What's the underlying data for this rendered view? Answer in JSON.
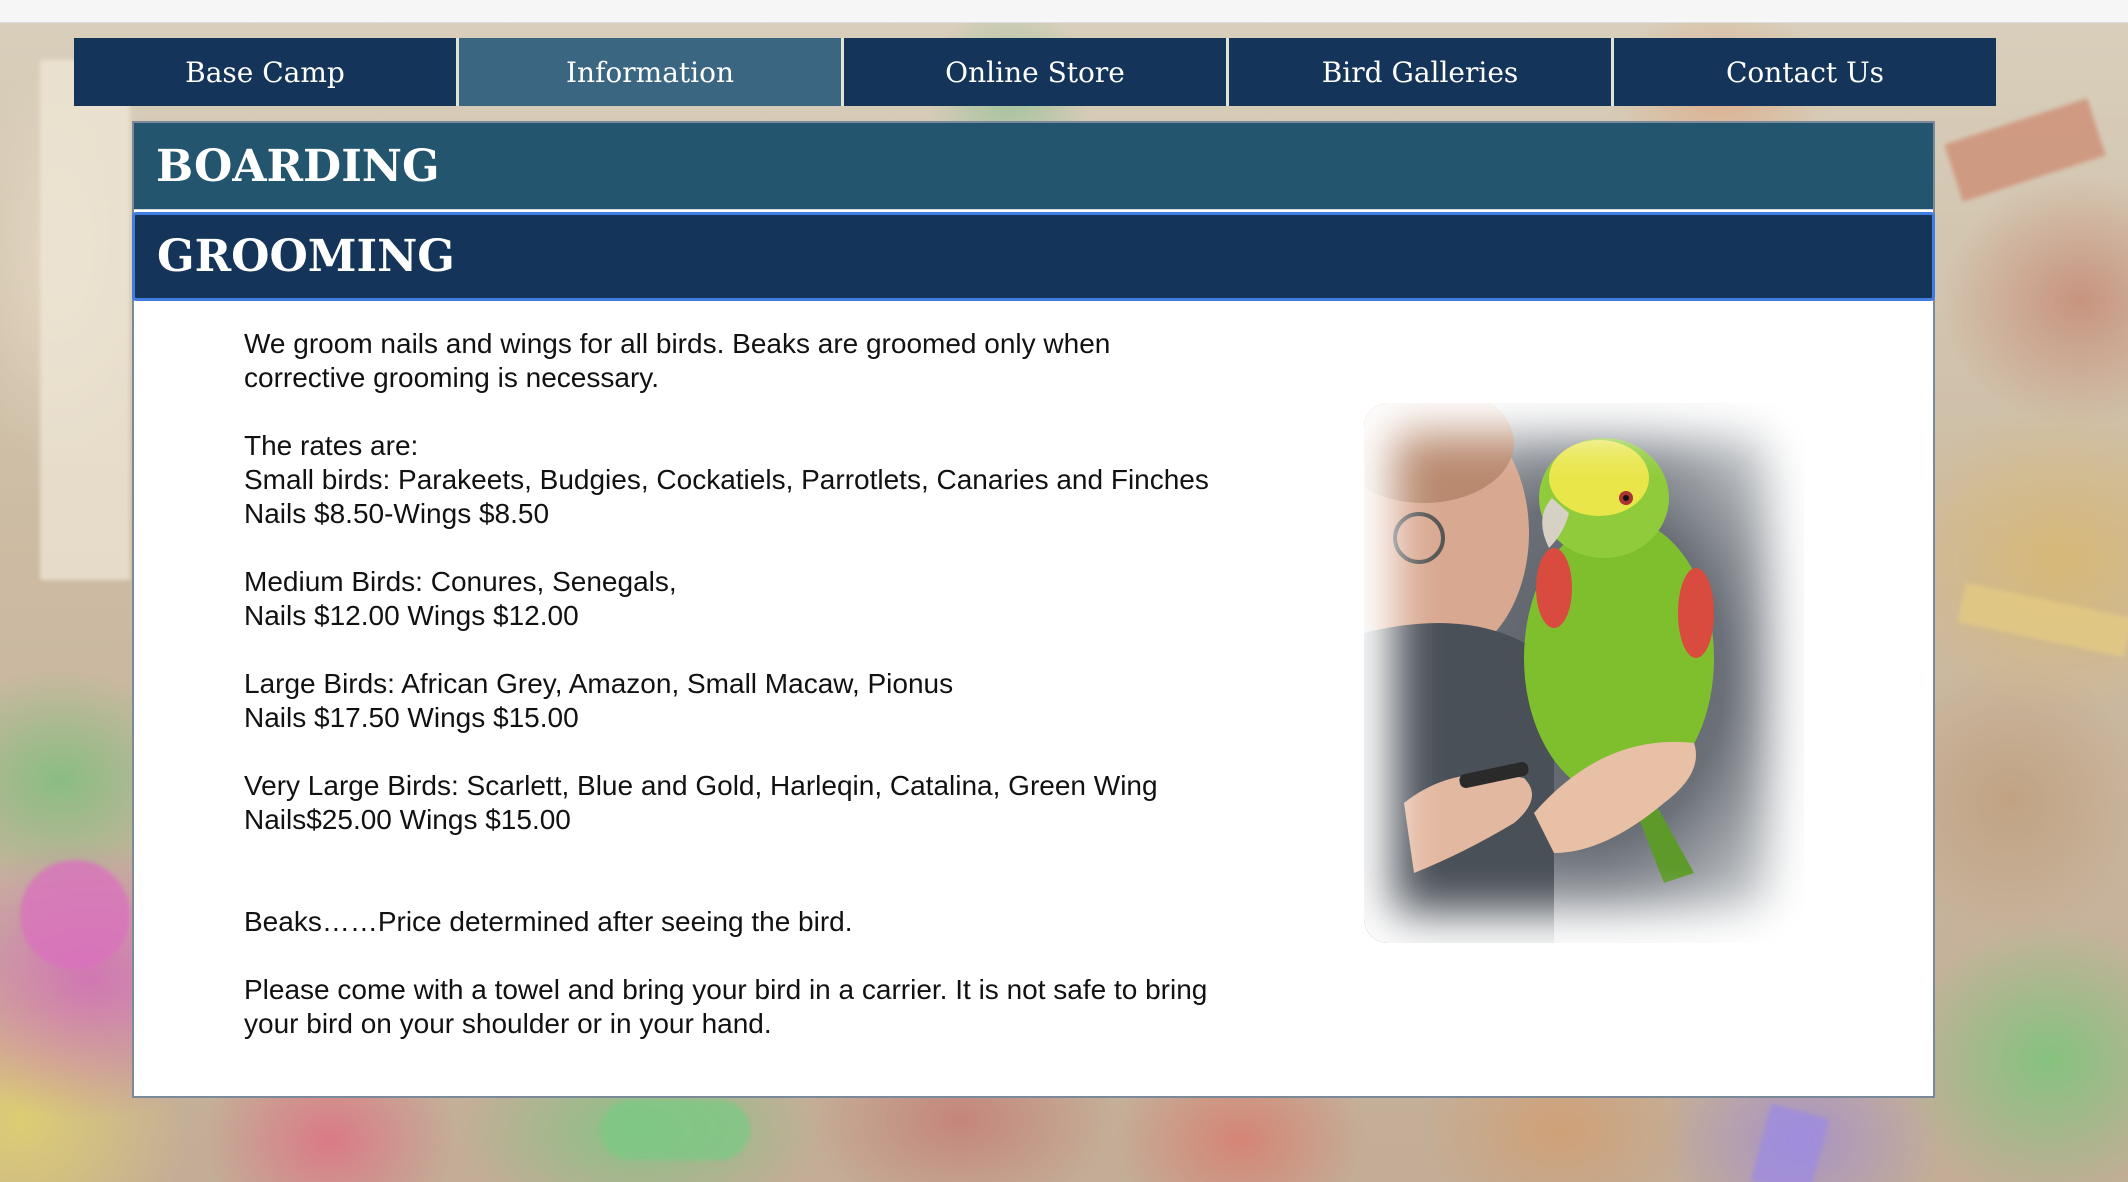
{
  "nav": {
    "items": [
      {
        "label": "Base Camp"
      },
      {
        "label": "Information"
      },
      {
        "label": "Online Store"
      },
      {
        "label": "Bird Galleries"
      },
      {
        "label": "Contact Us"
      }
    ],
    "active_index": 1
  },
  "accordion": {
    "boarding_title": "BOARDING",
    "grooming_title": "GROOMING"
  },
  "grooming": {
    "intro": "We groom nails and wings for all birds.  Beaks are groomed only when\ncorrective grooming is necessary.",
    "rates_heading": "The rates are:",
    "small_birds": "Small birds: Parakeets, Budgies, Cockatiels, Parrotlets, Canaries and Finches",
    "small_prices": "Nails $8.50-Wings $8.50",
    "medium_birds": "Medium Birds: Conures, Senegals,",
    "medium_prices": "Nails $12.00 Wings $12.00",
    "large_birds": "Large Birds: African Grey, Amazon, Small Macaw, Pionus",
    "large_prices": "Nails $17.50 Wings $15.00",
    "very_large_birds": "Very Large Birds: Scarlett, Blue and Gold, Harleqin, Catalina, Green Wing",
    "very_large_prices": "Nails$25.00 Wings $15.00",
    "beaks": "Beaks……Price determined after seeing the bird.",
    "carrier_note": "Please come with a towel and bring your bird in a carrier.  It is not safe to bring\nyour bird on your shoulder or in your hand."
  },
  "colors": {
    "nav_bg": "#143459",
    "nav_active_bg": "#3b6682",
    "boarding_bg": "#23556f",
    "grooming_bg": "#153459",
    "focus_border": "#3f7de0",
    "parrot_green": "#7fbf2e",
    "parrot_yellow": "#e9e64a"
  }
}
